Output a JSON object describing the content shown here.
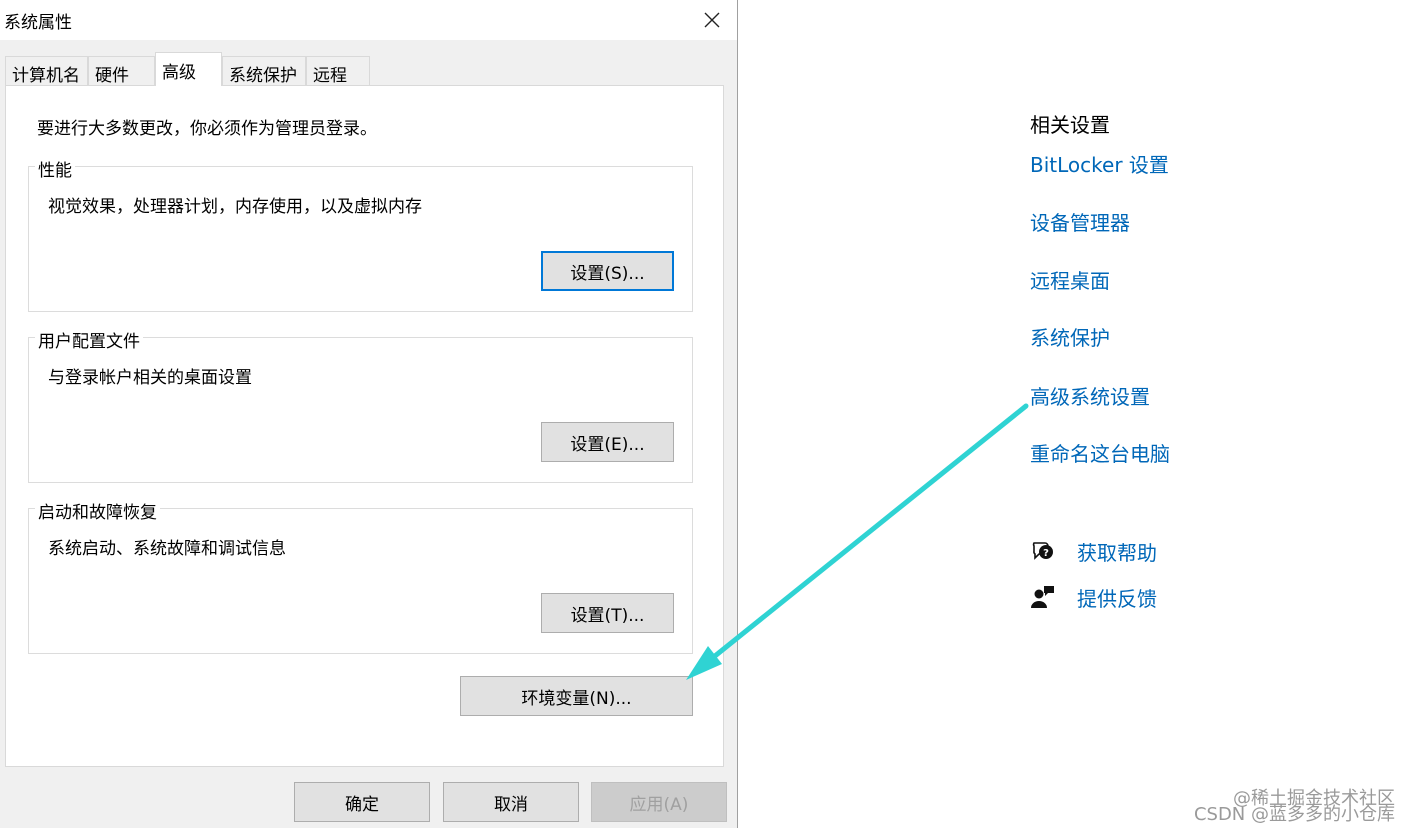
{
  "dialog": {
    "title": "系统属性",
    "tabs": [
      "计算机名",
      "硬件",
      "高级",
      "系统保护",
      "远程"
    ],
    "active_tab": "高级",
    "note": "要进行大多数更改，你必须作为管理员登录。",
    "groups": [
      {
        "label": "性能",
        "desc": "视觉效果，处理器计划，内存使用，以及虚拟内存",
        "button": "设置(S)..."
      },
      {
        "label": "用户配置文件",
        "desc": "与登录帐户相关的桌面设置",
        "button": "设置(E)..."
      },
      {
        "label": "启动和故障恢复",
        "desc": "系统启动、系统故障和调试信息",
        "button": "设置(T)..."
      }
    ],
    "env_button": "环境变量(N)...",
    "ok": "确定",
    "cancel": "取消",
    "apply": "应用(A)"
  },
  "settings": {
    "heading": "相关设置",
    "links": [
      "BitLocker 设置",
      "设备管理器",
      "远程桌面",
      "系统保护",
      "高级系统设置",
      "重命名这台电脑"
    ],
    "help": [
      {
        "icon": "help-chat-icon",
        "label": "获取帮助"
      },
      {
        "icon": "feedback-icon",
        "label": "提供反馈"
      }
    ]
  },
  "colors": {
    "link": "#0067b8",
    "arrow": "#2fd3d3",
    "focus": "#0078d7"
  },
  "watermark": {
    "line1": "@稀土掘金技术社区",
    "line2": "CSDN @蓝多多的小仓库"
  }
}
